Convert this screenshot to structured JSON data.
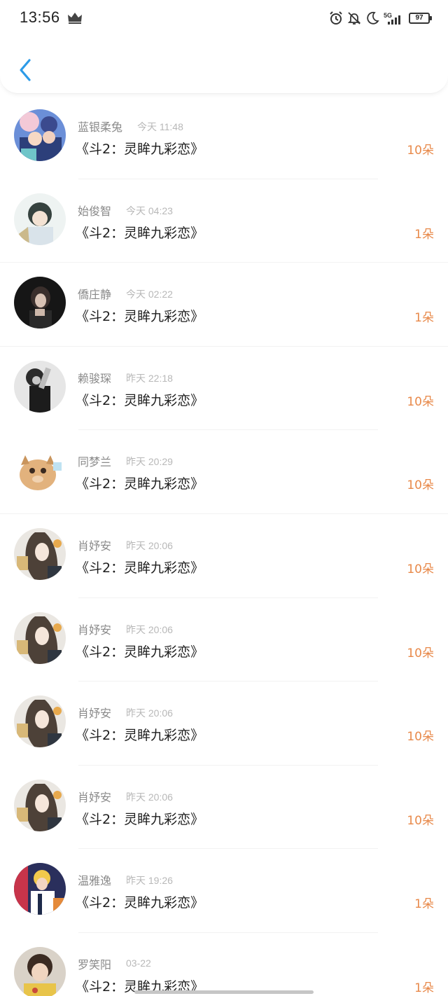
{
  "status_bar": {
    "time": "13:56",
    "battery": "97",
    "icons": [
      "crown-icon",
      "alarm-icon",
      "bell-off-icon",
      "moon-icon",
      "5g-signal-icon",
      "battery-icon"
    ]
  },
  "nav": {
    "back_icon": "chevron-left-icon"
  },
  "colors": {
    "accent": "#2c9be8",
    "amount": "#e8894a",
    "name": "#8a8a8a",
    "time": "#b8b8b8"
  },
  "records": [
    {
      "name": "蓝银柔兔",
      "time": "今天 11:48",
      "title": "《斗2：灵眸九彩恋》",
      "amount": "10朵"
    },
    {
      "name": "始俊智",
      "time": "今天 04:23",
      "title": "《斗2：灵眸九彩恋》",
      "amount": "1朵"
    },
    {
      "name": "僑庄静",
      "time": "今天 02:22",
      "title": "《斗2：灵眸九彩恋》",
      "amount": "1朵"
    },
    {
      "name": "赖骏琛",
      "time": "昨天 22:18",
      "title": "《斗2：灵眸九彩恋》",
      "amount": "10朵"
    },
    {
      "name": "同梦兰",
      "time": "昨天 20:29",
      "title": "《斗2：灵眸九彩恋》",
      "amount": "10朵"
    },
    {
      "name": "肖妤安",
      "time": "昨天 20:06",
      "title": "《斗2：灵眸九彩恋》",
      "amount": "10朵"
    },
    {
      "name": "肖妤安",
      "time": "昨天 20:06",
      "title": "《斗2：灵眸九彩恋》",
      "amount": "10朵"
    },
    {
      "name": "肖妤安",
      "time": "昨天 20:06",
      "title": "《斗2：灵眸九彩恋》",
      "amount": "10朵"
    },
    {
      "name": "肖妤安",
      "time": "昨天 20:06",
      "title": "《斗2：灵眸九彩恋》",
      "amount": "10朵"
    },
    {
      "name": "温雅逸",
      "time": "昨天 19:26",
      "title": "《斗2：灵眸九彩恋》",
      "amount": "1朵"
    },
    {
      "name": "罗笑阳",
      "time": "03-22",
      "title": "《斗2：灵眸九彩恋》",
      "amount": "1朵"
    }
  ]
}
